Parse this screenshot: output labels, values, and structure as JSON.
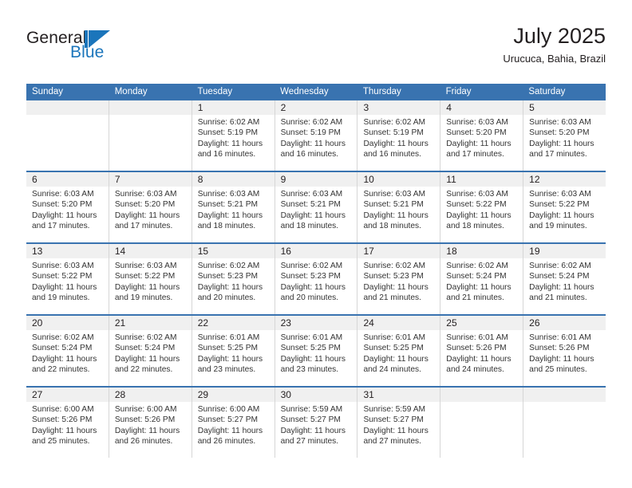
{
  "brand": {
    "name_part1": "General",
    "name_part2": "Blue",
    "logo_icon": "flag-triangle-icon",
    "accent_color": "#1b75bb"
  },
  "header": {
    "title": "July 2025",
    "subtitle": "Urucuca, Bahia, Brazil"
  },
  "theme": {
    "header_blue": "#3973b0",
    "daynum_band": "#f0f0f0",
    "cell_border": "#d6d6d6"
  },
  "weekdays": [
    "Sunday",
    "Monday",
    "Tuesday",
    "Wednesday",
    "Thursday",
    "Friday",
    "Saturday"
  ],
  "weeks": [
    [
      {
        "day": "",
        "lines": []
      },
      {
        "day": "",
        "lines": []
      },
      {
        "day": "1",
        "lines": [
          "Sunrise: 6:02 AM",
          "Sunset: 5:19 PM",
          "Daylight: 11 hours",
          "and 16 minutes."
        ]
      },
      {
        "day": "2",
        "lines": [
          "Sunrise: 6:02 AM",
          "Sunset: 5:19 PM",
          "Daylight: 11 hours",
          "and 16 minutes."
        ]
      },
      {
        "day": "3",
        "lines": [
          "Sunrise: 6:02 AM",
          "Sunset: 5:19 PM",
          "Daylight: 11 hours",
          "and 16 minutes."
        ]
      },
      {
        "day": "4",
        "lines": [
          "Sunrise: 6:03 AM",
          "Sunset: 5:20 PM",
          "Daylight: 11 hours",
          "and 17 minutes."
        ]
      },
      {
        "day": "5",
        "lines": [
          "Sunrise: 6:03 AM",
          "Sunset: 5:20 PM",
          "Daylight: 11 hours",
          "and 17 minutes."
        ]
      }
    ],
    [
      {
        "day": "6",
        "lines": [
          "Sunrise: 6:03 AM",
          "Sunset: 5:20 PM",
          "Daylight: 11 hours",
          "and 17 minutes."
        ]
      },
      {
        "day": "7",
        "lines": [
          "Sunrise: 6:03 AM",
          "Sunset: 5:20 PM",
          "Daylight: 11 hours",
          "and 17 minutes."
        ]
      },
      {
        "day": "8",
        "lines": [
          "Sunrise: 6:03 AM",
          "Sunset: 5:21 PM",
          "Daylight: 11 hours",
          "and 18 minutes."
        ]
      },
      {
        "day": "9",
        "lines": [
          "Sunrise: 6:03 AM",
          "Sunset: 5:21 PM",
          "Daylight: 11 hours",
          "and 18 minutes."
        ]
      },
      {
        "day": "10",
        "lines": [
          "Sunrise: 6:03 AM",
          "Sunset: 5:21 PM",
          "Daylight: 11 hours",
          "and 18 minutes."
        ]
      },
      {
        "day": "11",
        "lines": [
          "Sunrise: 6:03 AM",
          "Sunset: 5:22 PM",
          "Daylight: 11 hours",
          "and 18 minutes."
        ]
      },
      {
        "day": "12",
        "lines": [
          "Sunrise: 6:03 AM",
          "Sunset: 5:22 PM",
          "Daylight: 11 hours",
          "and 19 minutes."
        ]
      }
    ],
    [
      {
        "day": "13",
        "lines": [
          "Sunrise: 6:03 AM",
          "Sunset: 5:22 PM",
          "Daylight: 11 hours",
          "and 19 minutes."
        ]
      },
      {
        "day": "14",
        "lines": [
          "Sunrise: 6:03 AM",
          "Sunset: 5:22 PM",
          "Daylight: 11 hours",
          "and 19 minutes."
        ]
      },
      {
        "day": "15",
        "lines": [
          "Sunrise: 6:02 AM",
          "Sunset: 5:23 PM",
          "Daylight: 11 hours",
          "and 20 minutes."
        ]
      },
      {
        "day": "16",
        "lines": [
          "Sunrise: 6:02 AM",
          "Sunset: 5:23 PM",
          "Daylight: 11 hours",
          "and 20 minutes."
        ]
      },
      {
        "day": "17",
        "lines": [
          "Sunrise: 6:02 AM",
          "Sunset: 5:23 PM",
          "Daylight: 11 hours",
          "and 21 minutes."
        ]
      },
      {
        "day": "18",
        "lines": [
          "Sunrise: 6:02 AM",
          "Sunset: 5:24 PM",
          "Daylight: 11 hours",
          "and 21 minutes."
        ]
      },
      {
        "day": "19",
        "lines": [
          "Sunrise: 6:02 AM",
          "Sunset: 5:24 PM",
          "Daylight: 11 hours",
          "and 21 minutes."
        ]
      }
    ],
    [
      {
        "day": "20",
        "lines": [
          "Sunrise: 6:02 AM",
          "Sunset: 5:24 PM",
          "Daylight: 11 hours",
          "and 22 minutes."
        ]
      },
      {
        "day": "21",
        "lines": [
          "Sunrise: 6:02 AM",
          "Sunset: 5:24 PM",
          "Daylight: 11 hours",
          "and 22 minutes."
        ]
      },
      {
        "day": "22",
        "lines": [
          "Sunrise: 6:01 AM",
          "Sunset: 5:25 PM",
          "Daylight: 11 hours",
          "and 23 minutes."
        ]
      },
      {
        "day": "23",
        "lines": [
          "Sunrise: 6:01 AM",
          "Sunset: 5:25 PM",
          "Daylight: 11 hours",
          "and 23 minutes."
        ]
      },
      {
        "day": "24",
        "lines": [
          "Sunrise: 6:01 AM",
          "Sunset: 5:25 PM",
          "Daylight: 11 hours",
          "and 24 minutes."
        ]
      },
      {
        "day": "25",
        "lines": [
          "Sunrise: 6:01 AM",
          "Sunset: 5:26 PM",
          "Daylight: 11 hours",
          "and 24 minutes."
        ]
      },
      {
        "day": "26",
        "lines": [
          "Sunrise: 6:01 AM",
          "Sunset: 5:26 PM",
          "Daylight: 11 hours",
          "and 25 minutes."
        ]
      }
    ],
    [
      {
        "day": "27",
        "lines": [
          "Sunrise: 6:00 AM",
          "Sunset: 5:26 PM",
          "Daylight: 11 hours",
          "and 25 minutes."
        ]
      },
      {
        "day": "28",
        "lines": [
          "Sunrise: 6:00 AM",
          "Sunset: 5:26 PM",
          "Daylight: 11 hours",
          "and 26 minutes."
        ]
      },
      {
        "day": "29",
        "lines": [
          "Sunrise: 6:00 AM",
          "Sunset: 5:27 PM",
          "Daylight: 11 hours",
          "and 26 minutes."
        ]
      },
      {
        "day": "30",
        "lines": [
          "Sunrise: 5:59 AM",
          "Sunset: 5:27 PM",
          "Daylight: 11 hours",
          "and 27 minutes."
        ]
      },
      {
        "day": "31",
        "lines": [
          "Sunrise: 5:59 AM",
          "Sunset: 5:27 PM",
          "Daylight: 11 hours",
          "and 27 minutes."
        ]
      },
      {
        "day": "",
        "lines": []
      },
      {
        "day": "",
        "lines": []
      }
    ]
  ]
}
